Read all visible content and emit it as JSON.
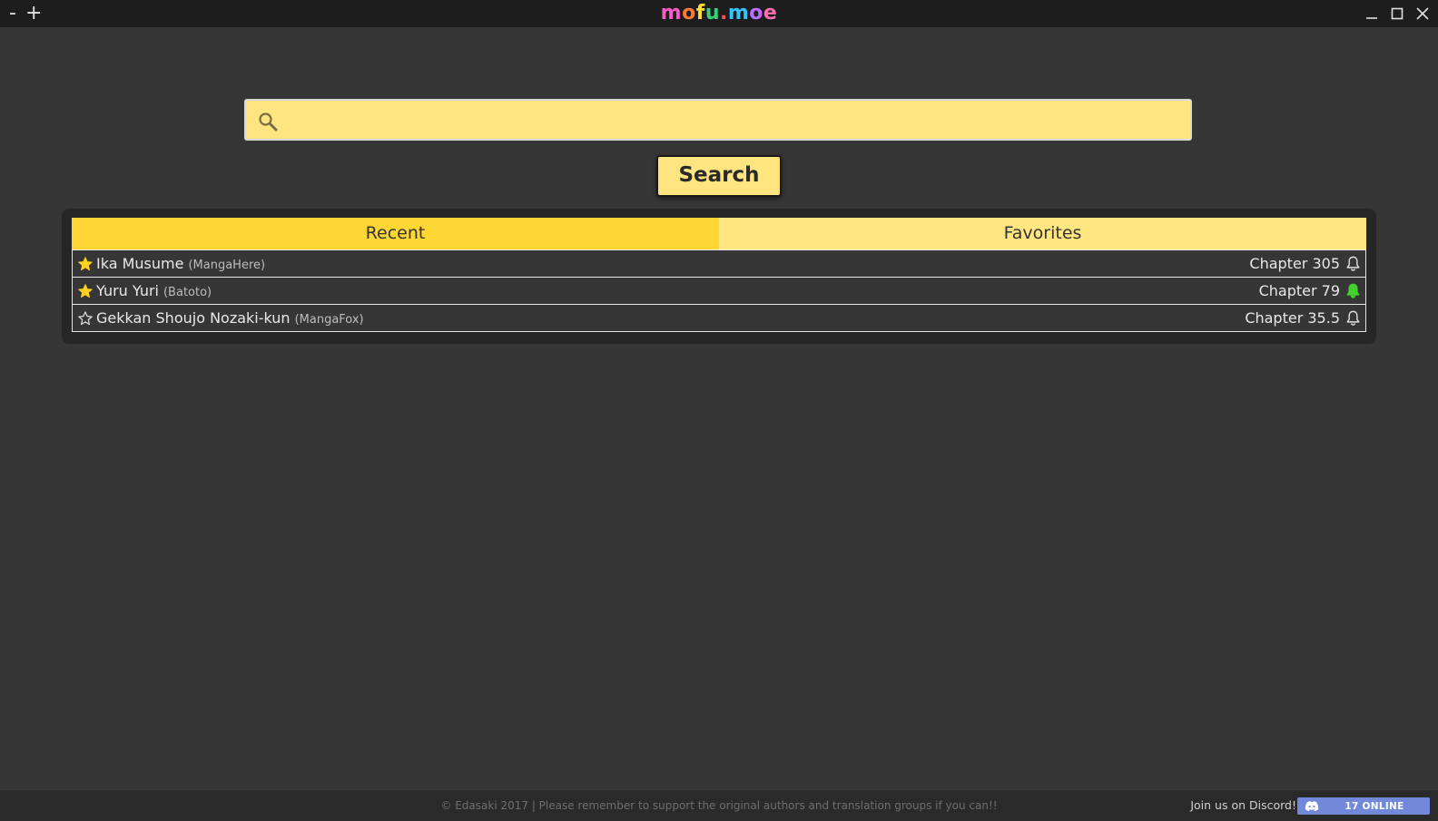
{
  "titlebar": {
    "zoom_out": "-",
    "zoom_in": "+",
    "logo": [
      "m",
      "o",
      "f",
      "u",
      ".",
      "m",
      "o",
      "e"
    ],
    "logo_colors": [
      "#ff59c7",
      "#ff7a33",
      "#ffe033",
      "#33d17a",
      "#ff4f4f",
      "#33c4ff",
      "#c06bff",
      "#ff6fb0"
    ],
    "window_icons": [
      "minimize-icon",
      "maximize-icon",
      "close-icon"
    ]
  },
  "search": {
    "placeholder": "",
    "value": "",
    "button_label": "Search",
    "icon": "search-icon"
  },
  "tabs": [
    {
      "label": "Recent",
      "active": true
    },
    {
      "label": "Favorites",
      "active": false
    }
  ],
  "list": [
    {
      "title": "Ika Musume",
      "source": "(MangaHere)",
      "chapter": "Chapter 305",
      "favorite": true,
      "bell": "outline"
    },
    {
      "title": "Yuru Yuri",
      "source": "(Batoto)",
      "chapter": "Chapter 79",
      "favorite": true,
      "bell": "filled-green"
    },
    {
      "title": "Gekkan Shoujo Nozaki-kun",
      "source": "(MangaFox)",
      "chapter": "Chapter 35.5",
      "favorite": false,
      "bell": "outline"
    }
  ],
  "footer": {
    "notice": "© Edasaki 2017 | Please remember to support the original authors and translation groups if you can!!",
    "discord_text": "Join us on Discord!",
    "discord_online": "17 ONLINE"
  },
  "colors": {
    "background": "#363636",
    "titlebar": "#1d1d1d",
    "accent_yellow": "#ffe57f",
    "tab_active": "#ffd633",
    "star": "#ffd21f",
    "bell_active": "#44d12f",
    "discord": "#7289da"
  }
}
